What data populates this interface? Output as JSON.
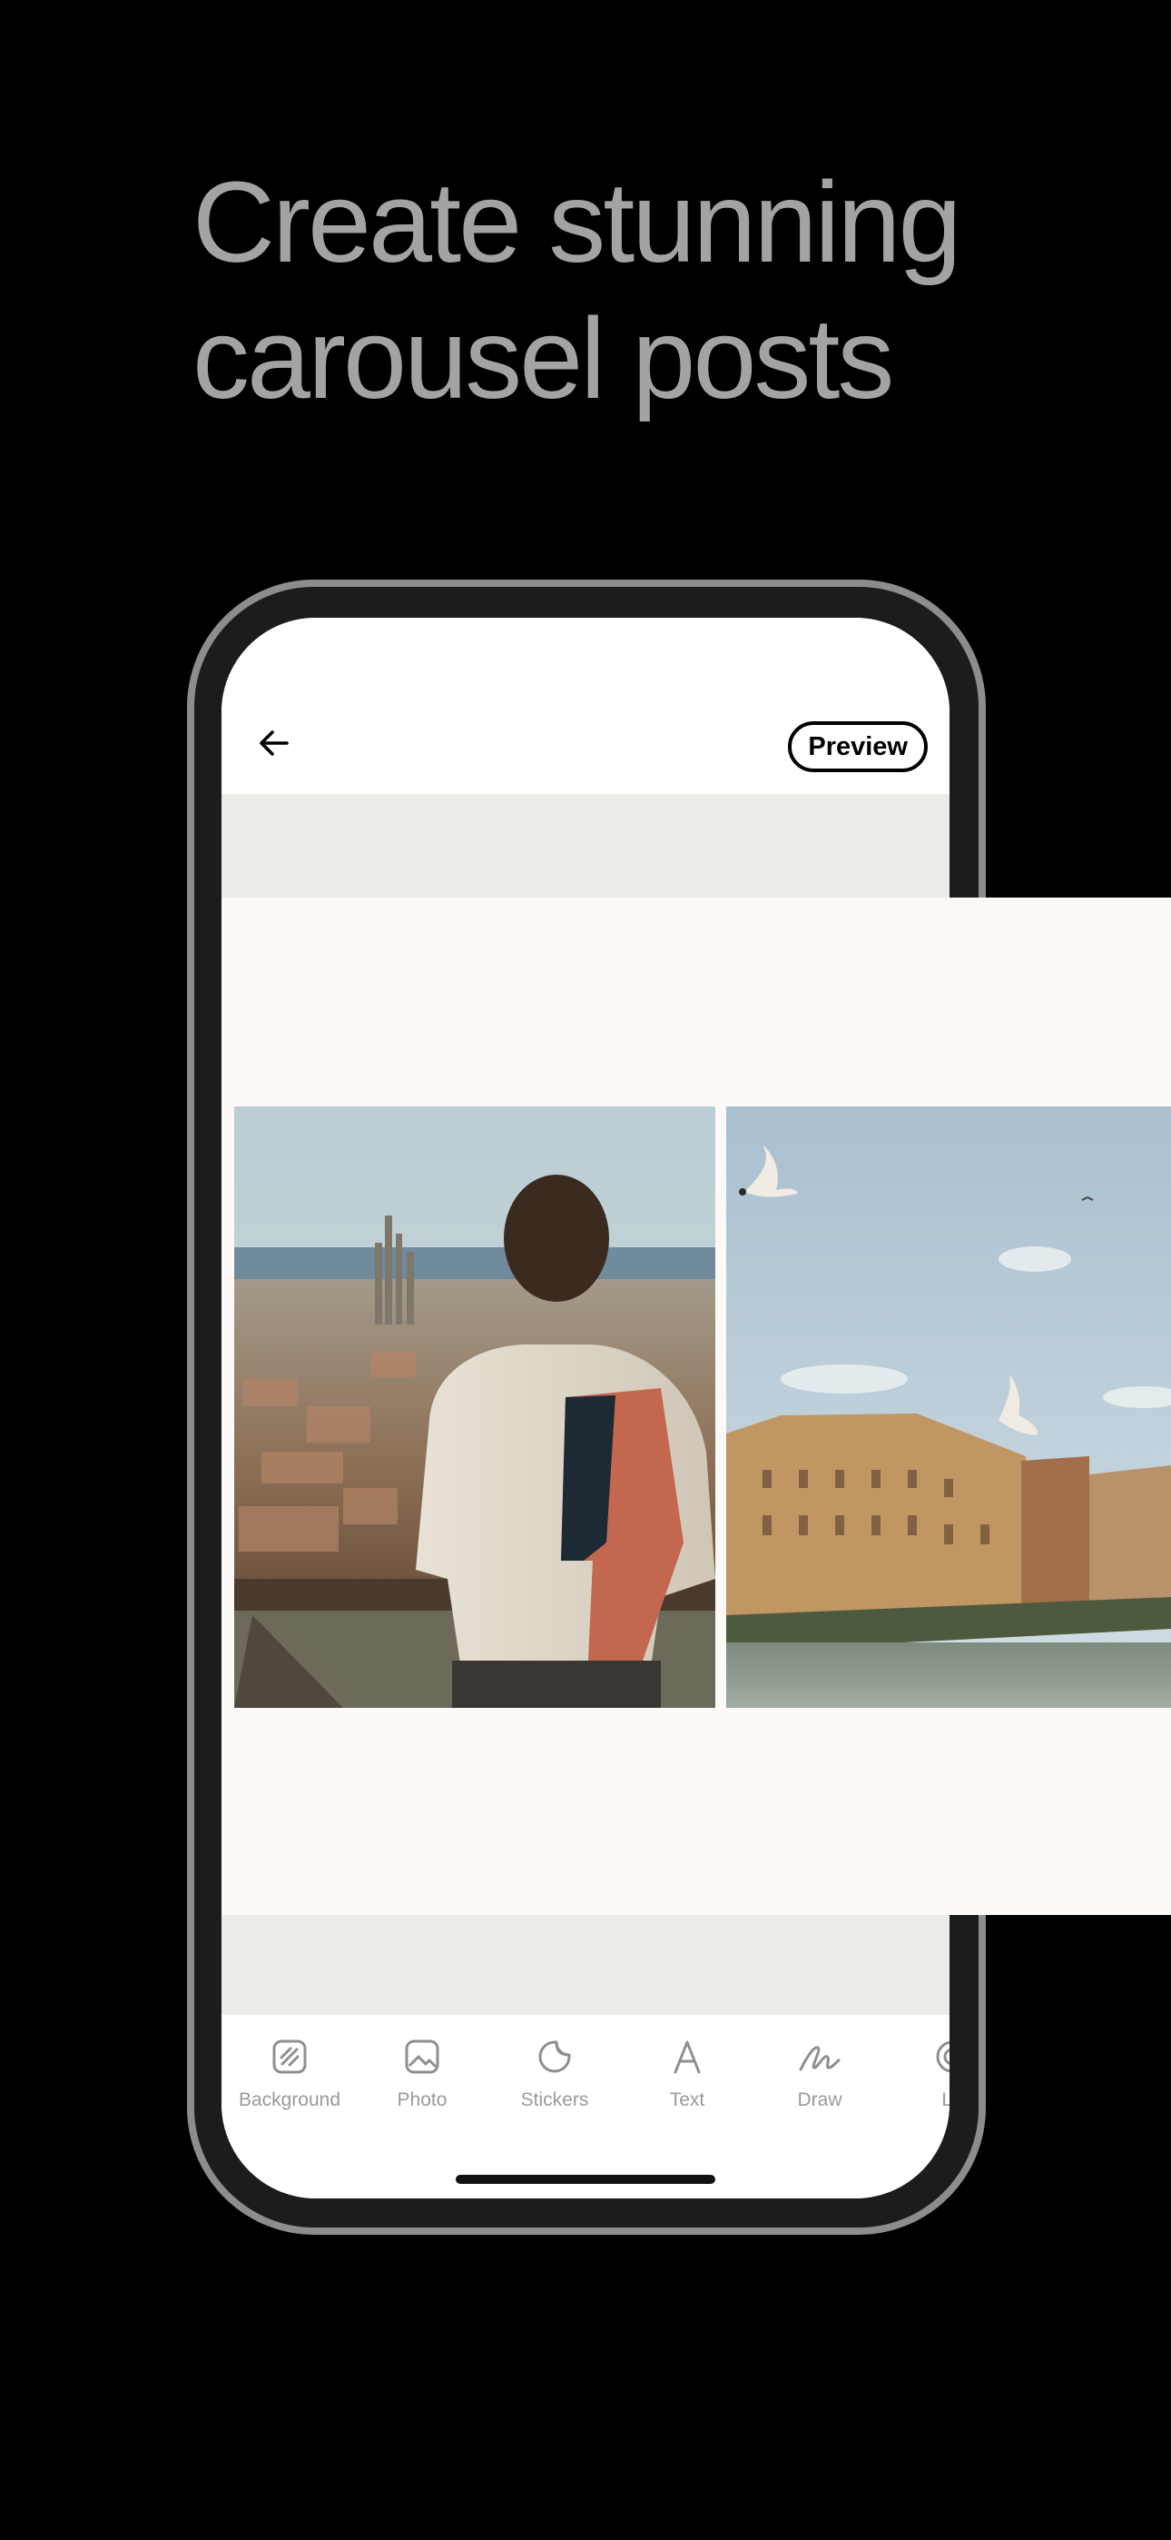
{
  "headline": {
    "line1": "Create stunning",
    "line2": "carousel posts"
  },
  "editor": {
    "back_icon": "arrow-left-icon",
    "preview_label": "Preview"
  },
  "toolbar": {
    "items": [
      {
        "label": "Background",
        "icon": "background-icon"
      },
      {
        "label": "Photo",
        "icon": "photo-icon"
      },
      {
        "label": "Stickers",
        "icon": "sticker-icon"
      },
      {
        "label": "Text",
        "icon": "text-icon"
      },
      {
        "label": "Draw",
        "icon": "draw-icon"
      },
      {
        "label": "Lo",
        "icon": "logo-icon"
      }
    ]
  },
  "colors": {
    "background": "#000000",
    "headline": "#a3a3a3",
    "canvas": "#edece8",
    "slide": "#fcf9f6",
    "toolbar_label": "#9a9a9a"
  }
}
